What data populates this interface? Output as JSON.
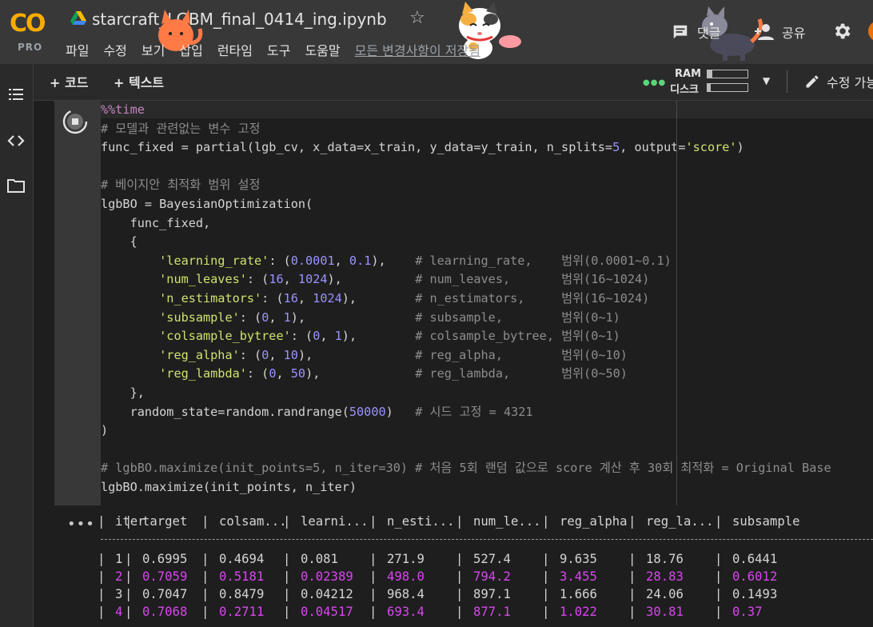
{
  "app": {
    "logo_text": "CO",
    "plan": "PRO"
  },
  "notebook": {
    "title": "starcraft_LGBM_final_0414_ing.ipynb"
  },
  "menu": [
    "파일",
    "수정",
    "보기",
    "삽입",
    "런타임",
    "도구",
    "도움말"
  ],
  "save_status": "모든 변경사항이 저장됨",
  "header_actions": {
    "comment": "댓글",
    "share": "공유"
  },
  "toolbar": {
    "add_code": "+ 코드",
    "add_text": "+ 텍스트",
    "ram": "RAM",
    "disk": "디스크",
    "edit_mode": "수정 가능",
    "ram_usage": 0.12,
    "disk_usage": 0.08
  },
  "colors": {
    "accent_logo": "#f9ab00",
    "string": "#cee36d",
    "number": "#9b93ff",
    "comment": "#8d8d8d",
    "highlight_row": "#d946ef"
  },
  "code_lines": [
    "%%time",
    "# 모델과 관련없는 변수 고정",
    "func_fixed = partial(lgb_cv, x_data=x_train, y_data=y_train, n_splits=5, output='score')",
    "",
    "# 베이지안 최적화 범위 설정",
    "lgbBO = BayesianOptimization(",
    "    func_fixed,",
    "    {",
    "        'learning_rate': (0.0001, 0.1),    # learning_rate,    범위(0.0001~0.1)",
    "        'num_leaves': (16, 1024),          # num_leaves,       범위(16~1024)",
    "        'n_estimators': (16, 1024),        # n_estimators,     범위(16~1024)",
    "        'subsample': (0, 1),               # subsample,        범위(0~1)",
    "        'colsample_bytree': (0, 1),        # colsample_bytree, 범위(0~1)",
    "        'reg_alpha': (0, 10),              # reg_alpha,        범위(0~10)",
    "        'reg_lambda': (0, 50),             # reg_lambda,       범위(0~50)",
    "    },",
    "    random_state=random.randrange(50000)   # 시드 고정 = 4321",
    ")",
    "",
    "# lgbBO.maximize(init_points=5, n_iter=30) # 처음 5회 랜덤 값으로 score 계산 후 30회 최적화 = Original Base",
    "lgbBO.maximize(init_points, n_iter)"
  ],
  "output": {
    "headers": [
      "iter",
      "target",
      "colsam...",
      "learni...",
      "n_esti...",
      "num_le...",
      "reg_alpha",
      "reg_la...",
      "subsample"
    ],
    "rows": [
      {
        "highlight": false,
        "cells": [
          "1",
          "0.6995",
          "0.4694",
          "0.081",
          "271.9",
          "527.4",
          "9.635",
          "18.76",
          "0.6441"
        ]
      },
      {
        "highlight": true,
        "cells": [
          "2",
          "0.7059",
          "0.5181",
          "0.02389",
          "498.0",
          "794.2",
          "3.455",
          "28.83",
          "0.6012"
        ]
      },
      {
        "highlight": false,
        "cells": [
          "3",
          "0.7047",
          "0.8479",
          "0.04212",
          "968.4",
          "897.1",
          "1.666",
          "24.06",
          "0.1493"
        ]
      },
      {
        "highlight": true,
        "cells": [
          "4",
          "0.7068",
          "0.2711",
          "0.04517",
          "693.4",
          "877.1",
          "1.022",
          "30.81",
          "0.37"
        ]
      }
    ]
  }
}
